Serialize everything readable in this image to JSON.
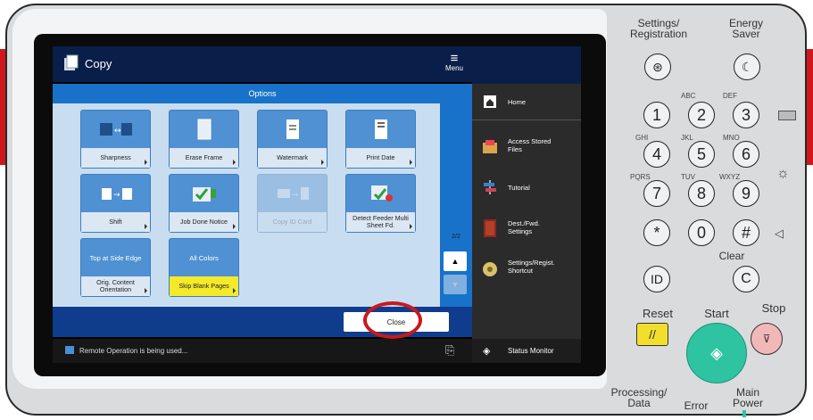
{
  "screen": {
    "app_title": "Copy",
    "menu_label": "Menu",
    "options_title": "Options",
    "tiles": [
      {
        "label": "Sharpness"
      },
      {
        "label": "Erase Frame"
      },
      {
        "label": "Watermark"
      },
      {
        "label": "Print Date"
      },
      {
        "label": "Shift"
      },
      {
        "label": "Job Done Notice"
      },
      {
        "label": "Copy ID Card"
      },
      {
        "label": "Detect Feeder Multi Sheet Fd."
      },
      {
        "top": "Top at Side Edge",
        "label": "Orig. Content Orientation"
      },
      {
        "top": "All Colors",
        "label": "Skip Blank Pages"
      }
    ],
    "page_indicator": "2/2",
    "close_label": "Close",
    "status_text": "Remote Operation is being used...",
    "right_menu": {
      "home": "Home",
      "access_stored_files": "Access Stored Files",
      "tutorial": "Tutorial",
      "dest_fwd_settings": "Dest./Fwd. Settings",
      "settings_regist_shortcut": "Settings/Regist. Shortcut",
      "status_monitor": "Status Monitor"
    }
  },
  "panel": {
    "settings_registration": "Settings/ Registration",
    "energy_saver": "Energy Saver",
    "keys": [
      "1",
      "2",
      "3",
      "4",
      "5",
      "6",
      "7",
      "8",
      "9",
      "*",
      "0",
      "#",
      "ID",
      "C"
    ],
    "key_letters": [
      "ABC",
      "DEF",
      "GHI",
      "JKL",
      "MNO",
      "PQRS",
      "TUV",
      "WXYZ"
    ],
    "clear": "Clear",
    "reset": "Reset",
    "start": "Start",
    "stop": "Stop",
    "processing_data": "Processing/ Data",
    "error": "Error",
    "main_power": "Main Power"
  },
  "colors": {
    "brand_red": "#d0171b",
    "start_green": "#2ec4a1",
    "reset_yellow": "#f2df2c",
    "highlight_circle": "#c8191e"
  }
}
